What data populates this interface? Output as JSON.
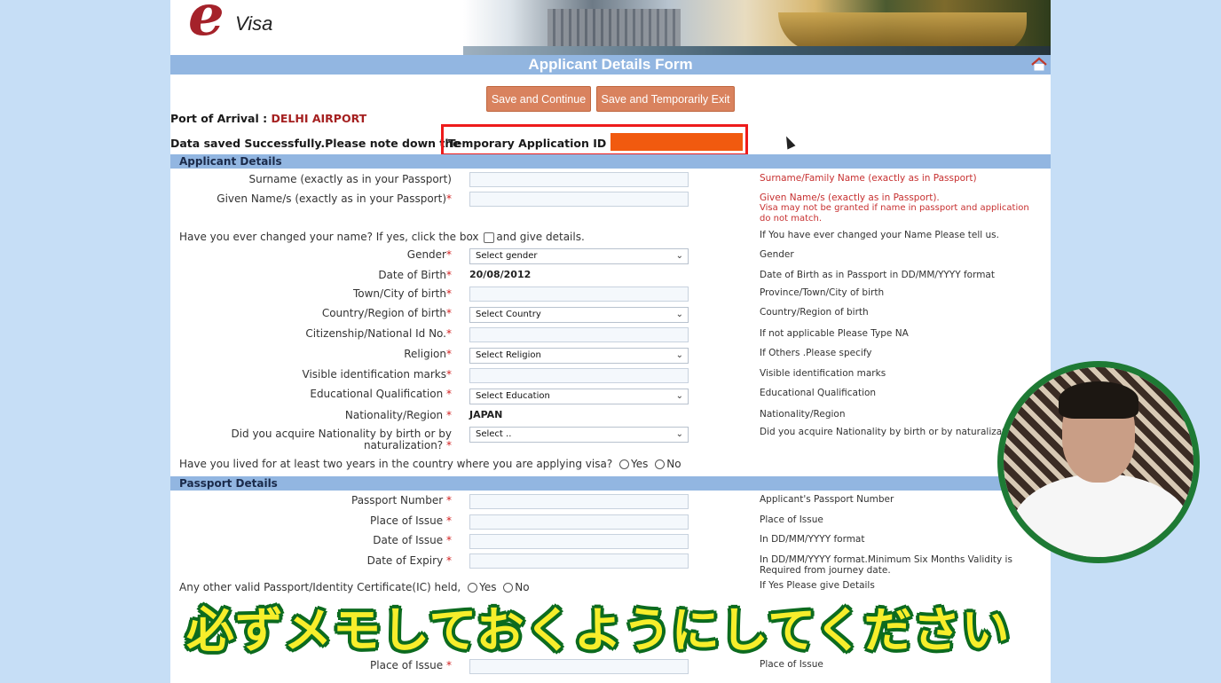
{
  "logo": {
    "e": "e",
    "visa": "Visa"
  },
  "title": "Applicant Details Form",
  "buttons": {
    "save_continue": "Save and Continue",
    "save_exit": "Save and Temporarily Exit"
  },
  "port": {
    "label": "Port of Arrival :",
    "value": "DELHI AIRPORT"
  },
  "saved_msg": {
    "text": "Data saved Successfully.Please note down the",
    "id_label": "Temporary Application ID :"
  },
  "sections": {
    "applicant": "Applicant Details",
    "passport": "Passport Details"
  },
  "fields": {
    "surname": {
      "label": "Surname (exactly as in your Passport)",
      "help": "Surname/Family Name (exactly as in Passport)"
    },
    "given": {
      "label": "Given Name/s (exactly as in your Passport)",
      "help": "Given Name/s (exactly as in Passport).",
      "help2": "Visa may not be granted if name in passport and application",
      "help3": "do not match."
    },
    "changed": {
      "label_a": "Have you ever changed your name? If yes, click the box",
      "label_b": "and give details.",
      "help": "If You have ever changed your Name Please tell us."
    },
    "gender": {
      "label": "Gender",
      "value": "Select gender",
      "help": "Gender"
    },
    "dob": {
      "label": "Date of Birth",
      "value": "20/08/2012",
      "help": "Date of Birth as in Passport in DD/MM/YYYY format"
    },
    "town": {
      "label": "Town/City of birth",
      "help": "Province/Town/City of birth"
    },
    "country": {
      "label": "Country/Region of birth",
      "value": "Select Country",
      "help": "Country/Region of birth"
    },
    "citizenship": {
      "label": "Citizenship/National Id No.",
      "help": "If not applicable Please Type NA"
    },
    "religion": {
      "label": "Religion",
      "value": "Select Religion",
      "help": "If Others .Please specify"
    },
    "marks": {
      "label": "Visible identification marks",
      "help": "Visible identification marks"
    },
    "education": {
      "label": "Educational Qualification",
      "value": "Select Education",
      "help": "Educational Qualification"
    },
    "nationality": {
      "label": "Nationality/Region",
      "value": "JAPAN",
      "help": "Nationality/Region"
    },
    "acquire": {
      "label1": "Did you acquire Nationality by birth or by",
      "label2": "naturalization?",
      "value": "Select ..",
      "help": "Did you acquire Nationality by birth or by naturalizatio"
    },
    "lived": {
      "label": "Have you lived for at least two years in the country where you are applying visa?",
      "yes": "Yes",
      "no": "No"
    },
    "passport_no": {
      "label": "Passport Number",
      "help": "Applicant's Passport Number"
    },
    "place_issue": {
      "label": "Place of Issue",
      "help": "Place of Issue"
    },
    "date_issue": {
      "label": "Date of Issue",
      "help": "In DD/MM/YYYY format"
    },
    "date_expiry": {
      "label": "Date of Expiry",
      "help": "In DD/MM/YYYY format.Minimum Six Months Validity is",
      "help2": "Required from journey date."
    },
    "other_passport": {
      "label": "Any other valid Passport/Identity Certificate(IC) held,",
      "yes": "Yes",
      "no": "No",
      "help": "If Yes Please give Details"
    },
    "place_issue2": {
      "label": "Place of Issue",
      "help": "Place of Issue"
    }
  },
  "star": "*",
  "subtitle": "必ずメモしておくようにしてください",
  "colors": {
    "accent": "#92b6e1",
    "button": "#d9825e",
    "highlight": "#ee1b1b",
    "redact": "#f15a0f",
    "subtitle_fill": "#f7ee2b",
    "subtitle_stroke": "#0c6b1f"
  }
}
